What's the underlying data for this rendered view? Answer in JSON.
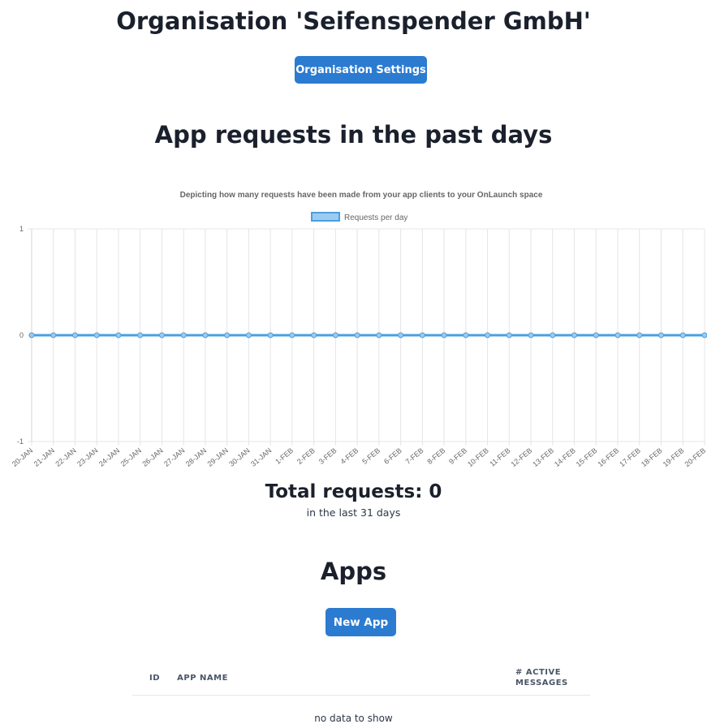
{
  "header": {
    "title": "Organisation 'Seifenspender GmbH'",
    "settings_button": "Organisation Settings"
  },
  "requests": {
    "title": "App requests in the past days",
    "total_label": "Total requests: 0",
    "total_sub": "in the last 31 days"
  },
  "chart_data": {
    "type": "line",
    "title": "Depicting how many requests have been made from your app clients to your OnLaunch space",
    "xlabel": "",
    "ylabel": "",
    "categories": [
      "20-JAN",
      "21-JAN",
      "22-JAN",
      "23-JAN",
      "24-JAN",
      "25-JAN",
      "26-JAN",
      "27-JAN",
      "28-JAN",
      "29-JAN",
      "30-JAN",
      "31-JAN",
      "1-FEB",
      "2-FEB",
      "3-FEB",
      "4-FEB",
      "5-FEB",
      "6-FEB",
      "7-FEB",
      "8-FEB",
      "9-FEB",
      "10-FEB",
      "11-FEB",
      "12-FEB",
      "13-FEB",
      "14-FEB",
      "15-FEB",
      "16-FEB",
      "17-FEB",
      "18-FEB",
      "19-FEB",
      "20-FEB"
    ],
    "series": [
      {
        "name": "Requests per day",
        "values": [
          0,
          0,
          0,
          0,
          0,
          0,
          0,
          0,
          0,
          0,
          0,
          0,
          0,
          0,
          0,
          0,
          0,
          0,
          0,
          0,
          0,
          0,
          0,
          0,
          0,
          0,
          0,
          0,
          0,
          0,
          0,
          0
        ]
      }
    ],
    "ylim": [
      -1,
      1
    ],
    "yticks": [
      "1",
      "0",
      "-1"
    ],
    "grid": true,
    "legend": "top-center",
    "colors": {
      "line": "#4a9fe0",
      "fill": "#9ccbf0"
    }
  },
  "apps": {
    "title": "Apps",
    "new_button": "New App",
    "columns": [
      "ID",
      "APP NAME",
      "# ACTIVE MESSAGES"
    ],
    "empty_text": "no data to show"
  },
  "colors": {
    "accent": "#2b7bd0"
  }
}
